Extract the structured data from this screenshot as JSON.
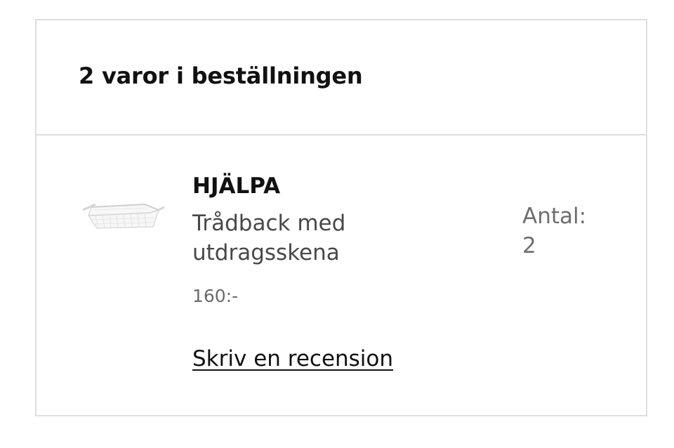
{
  "order": {
    "title": "2 varor i beställningen"
  },
  "item": {
    "image_icon": "wire-basket-icon",
    "name": "HJÄLPA",
    "description": "Trådback med utdragsskena",
    "price": "160:-",
    "quantity_label": "Antal:",
    "quantity_value": "2",
    "review_link": "Skriv en recension"
  },
  "colors": {
    "border": "#dfdfdf",
    "text_primary": "#111111",
    "text_secondary": "#484848",
    "text_muted": "#6b6b6b"
  }
}
